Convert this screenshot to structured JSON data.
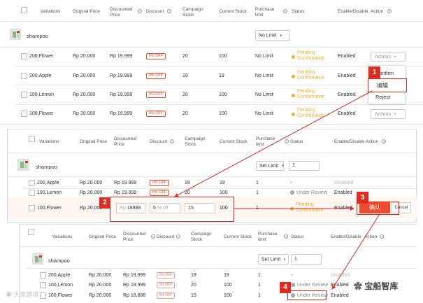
{
  "headers1": {
    "variations": "Variations",
    "original_price": "Original Price",
    "discounted_price": "Discounted Price",
    "discount": "Discount",
    "campaign_stock": "Campaign Stock",
    "current_stock": "Current Stock",
    "purchase_limit": "Purchase limit",
    "status": "Status",
    "enable_disable": "Enable/Disable",
    "action": "Action"
  },
  "headers2": {
    "variations": "Variations",
    "original_price": "Original Price",
    "discounted_price": "Discounted Price",
    "discount": "Discount",
    "campaign_stock": "Campaign Stock",
    "current_stock": "Current Stock",
    "purchase_limit": "Purchase limit",
    "status": "Status",
    "enable_disable": "Enable/Disable",
    "action": "Action"
  },
  "headers3": {
    "variations": "Variations",
    "original_price": "Original Price",
    "discounted_price": "Discounted Price",
    "discount": "Discount",
    "campaign_stock": "Campaign Stock",
    "current_stock": "Current Stock",
    "purchase_limit": "Purchase limit",
    "status": "Status",
    "enable_disable": "Enable/Disable",
    "action": "Action"
  },
  "panel1": {
    "product": "shampoo",
    "limit_select": "No Limit",
    "rows": [
      {
        "variation": "200,Flower",
        "original": "Rp 20.000",
        "discounted": "Rp 19.999",
        "discount": "0% OFF",
        "campaign_stock": "20",
        "current_stock": "100",
        "purchase_limit": "No Limit",
        "status": "Pending Confirmation",
        "enable": "Enabled",
        "action": "Actions"
      },
      {
        "variation": "200,Apple",
        "original": "Rp 20.000",
        "discounted": "Rp 19.999",
        "discount": "0% OFF",
        "campaign_stock": "19",
        "current_stock": "19",
        "purchase_limit": "No Limit",
        "status": "Pending Confirmation",
        "enable": "Enabled"
      },
      {
        "variation": "100,Lemon",
        "original": "Rp 20.000",
        "discounted": "Rp 19.999",
        "discount": "0% OFF",
        "campaign_stock": "20",
        "current_stock": "100",
        "purchase_limit": "No Limit",
        "status": "Pending Confirmation",
        "enable": "Enabled"
      },
      {
        "variation": "100,Flower",
        "original": "Rp 20.000",
        "discounted": "Rp 19.999",
        "discount": "0% OFF",
        "campaign_stock": "20",
        "current_stock": "100",
        "purchase_limit": "No Limit",
        "status": "Pending Confirmation",
        "enable": "Enabled",
        "action": "Actions"
      }
    ],
    "menu": {
      "confirm": "Confirm",
      "edit": "编辑",
      "reject": "Reject"
    }
  },
  "panel2": {
    "product": "shampoo",
    "set_limit": "Set Limit",
    "set_limit_value": "1",
    "rows": [
      {
        "variation": "200,Apple",
        "original": "Rp 20.000",
        "discounted": "Rp 19.999",
        "discount": "0% OFF",
        "campaign_stock": "19",
        "current_stock": "19",
        "purchase_limit": "1",
        "status": "-",
        "enable": "Disabled"
      },
      {
        "variation": "100,Lemon",
        "original": "Rp 20.000",
        "discounted": "Rp 19.999",
        "discount": "0% OFF",
        "campaign_stock": "20",
        "current_stock": "100",
        "purchase_limit": "1",
        "status": "Under Review",
        "enable": "Enabled"
      }
    ],
    "edit_row": {
      "variation": "100,Flower",
      "original": "Rp 20.000",
      "currency": "Rp",
      "price": "18888",
      "discount_value": "5",
      "discount_suffix": "% off",
      "campaign_stock": "15",
      "current_stock": "100",
      "purchase_limit": "1",
      "status": "Pending Confirmation",
      "enable": "Enabled",
      "confirm": "确认",
      "cancel": "Cancel"
    }
  },
  "panel3": {
    "product": "shampoo",
    "set_limit": "Set Limit",
    "set_limit_value": "1",
    "rows": [
      {
        "variation": "200,Apple",
        "original": "Rp 20.000",
        "discounted": "Rp 19.999",
        "discount": "0% OFF",
        "campaign_stock": "19",
        "current_stock": "19",
        "purchase_limit": "1",
        "status": "-",
        "enable": "Disabled"
      },
      {
        "variation": "100,Lemon",
        "original": "Rp 20.000",
        "discounted": "Rp 19.999",
        "discount": "0% OFF",
        "campaign_stock": "20",
        "current_stock": "100",
        "purchase_limit": "1",
        "status": "Under Review",
        "enable": "Enabled"
      },
      {
        "variation": "100,Flower",
        "original": "Rp 20.000",
        "discounted": "Rp 18.888",
        "discount": "5% OFF",
        "campaign_stock": "15",
        "current_stock": "100",
        "purchase_limit": "1",
        "status": "Under Review",
        "enable": "Enabled"
      }
    ]
  },
  "annotations": {
    "step1": "1",
    "step2": "2",
    "step3": "3",
    "step4": "4"
  },
  "watermarks": {
    "left": "大象跨境",
    "right": "宝船智库"
  },
  "colors": {
    "accent": "#ee4d2d",
    "annotation": "#e02b20",
    "pending": "#f2b130"
  }
}
